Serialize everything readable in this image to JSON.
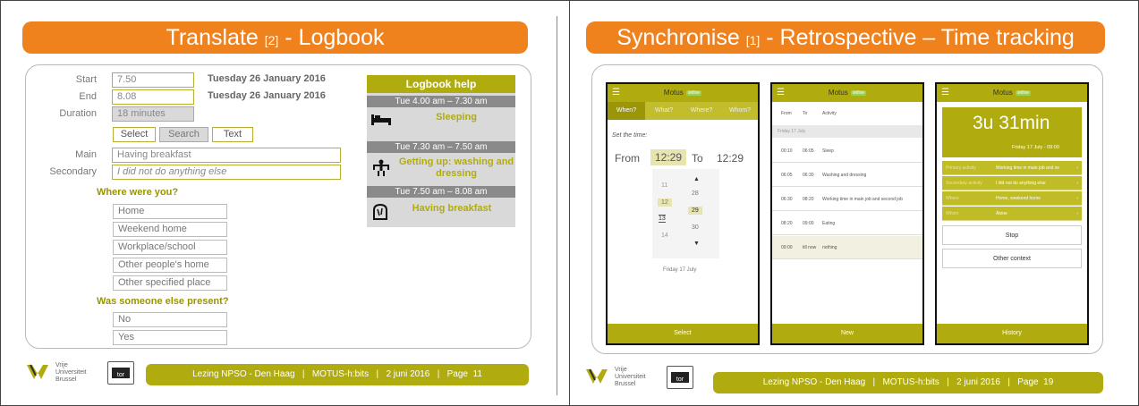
{
  "left_slide": {
    "title_main": "Translate ",
    "title_ref": "[2]",
    "title_rest": " - Logbook",
    "form": {
      "start_label": "Start",
      "start_value": "7.50",
      "start_date": "Tuesday 26 January 2016",
      "end_label": "End",
      "end_value": "8.08",
      "end_date": "Tuesday 26 January 2016",
      "duration_label": "Duration",
      "duration_value": "18 minutes",
      "select_label": "Select",
      "search_label": "Search",
      "text_label": "Text",
      "main_label": "Main",
      "main_value": "Having breakfast",
      "secondary_label": "Secondary",
      "secondary_value": "I did not do anything else",
      "where_question": "Where were you?",
      "where_options": [
        "Home",
        "Weekend home",
        "Workplace/school",
        "Other people's home",
        "Other specified place"
      ],
      "someone_question": "Was someone else present?",
      "someone_options": [
        "No",
        "Yes"
      ]
    },
    "help": {
      "title": "Logbook help",
      "entries": [
        {
          "time": "Tue 4.00 am – 7.30 am",
          "activity": "Sleeping",
          "icon": "bed-icon"
        },
        {
          "time": "Tue 7.30 am – 7.50 am",
          "activity": "Getting up: washing and dressing",
          "icon": "washing-icon"
        },
        {
          "time": "Tue 7.50 am – 8.08 am",
          "activity": "Having breakfast",
          "icon": "breakfast-icon"
        }
      ]
    },
    "footer": "Lezing NPSO - Den Haag   |   MOTUS-h:bits   |   2 juni 2016   |   Page  11"
  },
  "right_slide": {
    "title_main": "Synchronise ",
    "title_ref": "[1]",
    "title_rest": " - Retrospective – Time tracking",
    "app_name": "Motus",
    "online_badge": "online",
    "phone1": {
      "tabs": [
        "When?",
        "What?",
        "Where?",
        "Whom?"
      ],
      "set_time": "Set the time:",
      "from_label": "From",
      "from_value": "12:29",
      "to_label": "To",
      "to_value": "12:29",
      "hours": [
        "11",
        "12",
        "13",
        "14"
      ],
      "minutes": [
        "28",
        "29",
        "30"
      ],
      "date": "Friday 17 July",
      "footer": "Select"
    },
    "phone2": {
      "col_from": "From",
      "col_to": "To",
      "col_activity": "Activity",
      "date": "Friday 17 July",
      "rows": [
        {
          "from": "00:10",
          "to": "06:05",
          "activity": "Sleep"
        },
        {
          "from": "06:05",
          "to": "06:30",
          "activity": "Washing and dressing"
        },
        {
          "from": "06:30",
          "to": "08:20",
          "activity": "Working time in main job and second job"
        },
        {
          "from": "08:20",
          "to": "09:00",
          "activity": "Eating"
        },
        {
          "from": "09:00",
          "to": "till now",
          "activity": "nothing"
        }
      ],
      "footer": "New"
    },
    "phone3": {
      "duration": "3u 31min",
      "date_time": "Friday 17 July - 09:00",
      "details": [
        {
          "label": "Primary activity",
          "value": "Working time in main job and se"
        },
        {
          "label": "Secondary activity",
          "value": "I did not do anything else"
        },
        {
          "label": "Where",
          "value": "Home, weekend home"
        },
        {
          "label": "Whom",
          "value": "Alone"
        }
      ],
      "stop": "Stop",
      "other_context": "Other context",
      "footer": "History"
    },
    "footer": "Lezing NPSO - Den Haag   |   MOTUS-h:bits   |   2 juni 2016   |   Page  19"
  },
  "logo": {
    "line1": "Vrije",
    "line2": "Universiteit",
    "line3": "Brussel"
  },
  "colors": {
    "orange": "#f0821e",
    "olive": "#b0ac10"
  }
}
